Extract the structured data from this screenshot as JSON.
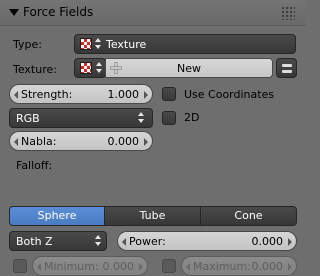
{
  "panel": {
    "title": "Force Fields"
  },
  "type": {
    "label": "Type:",
    "value": "Texture"
  },
  "texture": {
    "label": "Texture:",
    "new_label": "New"
  },
  "strength": {
    "label": "Strength:",
    "value": "1.000"
  },
  "use_coordinates": {
    "label": "Use Coordinates",
    "checked": false
  },
  "mode": {
    "value": "RGB"
  },
  "two_d": {
    "label": "2D",
    "checked": false
  },
  "nabla": {
    "label": "Nabla:",
    "value": "0.000"
  },
  "falloff": {
    "label": "Falloff:",
    "shapes": [
      "Sphere",
      "Tube",
      "Cone"
    ],
    "selected": "Sphere",
    "axis": "Both Z",
    "power_label": "Power:",
    "power_value": "0.000",
    "minimum_label": "Minimum:",
    "minimum_value": "0.000",
    "maximum_label": "Maximum:",
    "maximum_value": "0.000"
  },
  "colors": {
    "background": "#6e6e6e",
    "accent": "#5a8ed6",
    "dark_widget": "#3e3e3e",
    "light_widget": "#cecece"
  },
  "icons": [
    "disclosure-triangle-icon",
    "drag-grip-icon",
    "texture-checker-icon",
    "up-down-arrows-icon",
    "plus-icon",
    "duplicate-icon"
  ]
}
